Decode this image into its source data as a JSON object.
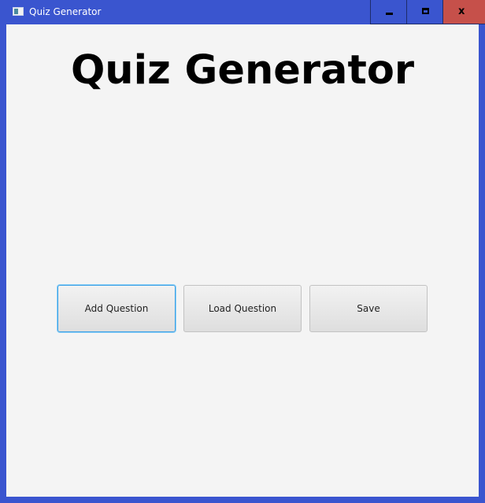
{
  "window": {
    "title": "Quiz Generator",
    "controls": {
      "minimize_icon": "minimize-icon",
      "maximize_icon": "maximize-icon",
      "close_label": "x"
    },
    "colors": {
      "frame": "#3a55cf",
      "close_button": "#c6504a",
      "client_background": "#f4f4f4",
      "focus_ring": "#3aa0e6"
    }
  },
  "main": {
    "heading": "Quiz Generator",
    "buttons": {
      "add_question": "Add Question",
      "load_question": "Load Question",
      "save": "Save"
    },
    "focused_button": "Add Question"
  }
}
